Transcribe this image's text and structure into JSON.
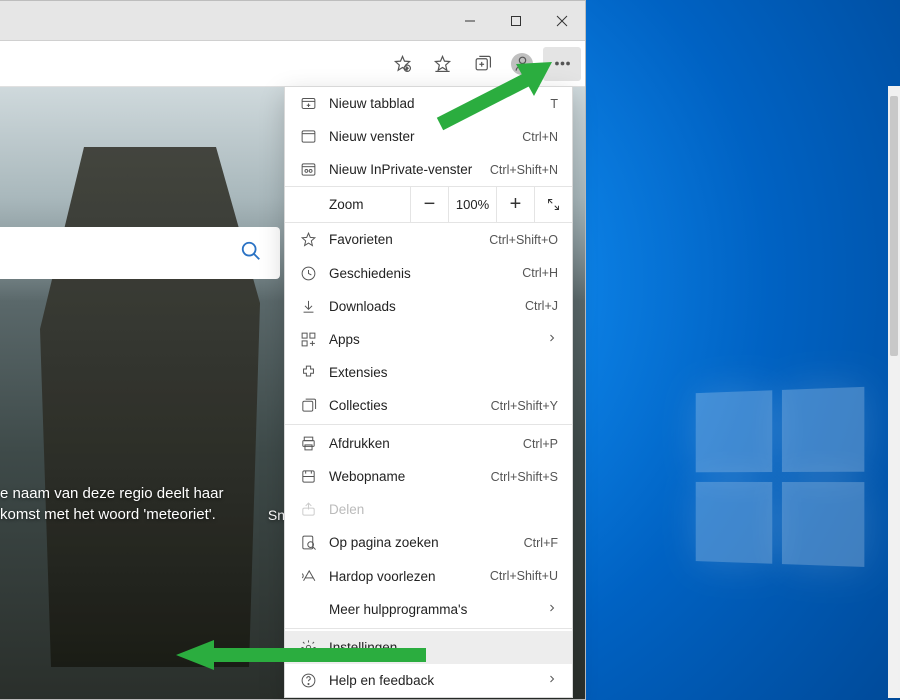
{
  "window": {
    "minimize_tip": "Minimaliseren",
    "maximize_tip": "Maximaliseren",
    "close_tip": "Sluiten"
  },
  "toolbar": {
    "add_favorite_tip": "Deze pagina toevoegen aan favorieten",
    "favorites_tip": "Favorieten",
    "collections_tip": "Collecties",
    "profile_tip": "Profiel",
    "menu_tip": "Instellingen en meer"
  },
  "content": {
    "caption_line1": "e naam van deze regio deelt haar",
    "caption_line2": "komst met het woord 'meteoriet'.",
    "snippet": "Sn"
  },
  "menu": {
    "new_tab": {
      "label": "Nieuw tabblad",
      "shortcut": "T"
    },
    "new_window": {
      "label": "Nieuw venster",
      "shortcut": "Ctrl+N"
    },
    "new_inprivate": {
      "label": "Nieuw InPrivate-venster",
      "shortcut": "Ctrl+Shift+N"
    },
    "zoom": {
      "label": "Zoom",
      "value": "100%"
    },
    "favorites": {
      "label": "Favorieten",
      "shortcut": "Ctrl+Shift+O"
    },
    "history": {
      "label": "Geschiedenis",
      "shortcut": "Ctrl+H"
    },
    "downloads": {
      "label": "Downloads",
      "shortcut": "Ctrl+J"
    },
    "apps": {
      "label": "Apps"
    },
    "extensions": {
      "label": "Extensies"
    },
    "collections": {
      "label": "Collecties",
      "shortcut": "Ctrl+Shift+Y"
    },
    "print": {
      "label": "Afdrukken",
      "shortcut": "Ctrl+P"
    },
    "webcapture": {
      "label": "Webopname",
      "shortcut": "Ctrl+Shift+S"
    },
    "share": {
      "label": "Delen"
    },
    "find": {
      "label": "Op pagina zoeken",
      "shortcut": "Ctrl+F"
    },
    "read_aloud": {
      "label": "Hardop voorlezen",
      "shortcut": "Ctrl+Shift+U"
    },
    "more_tools": {
      "label": "Meer hulpprogramma's"
    },
    "settings": {
      "label": "Instellingen"
    },
    "help": {
      "label": "Help en feedback"
    }
  }
}
